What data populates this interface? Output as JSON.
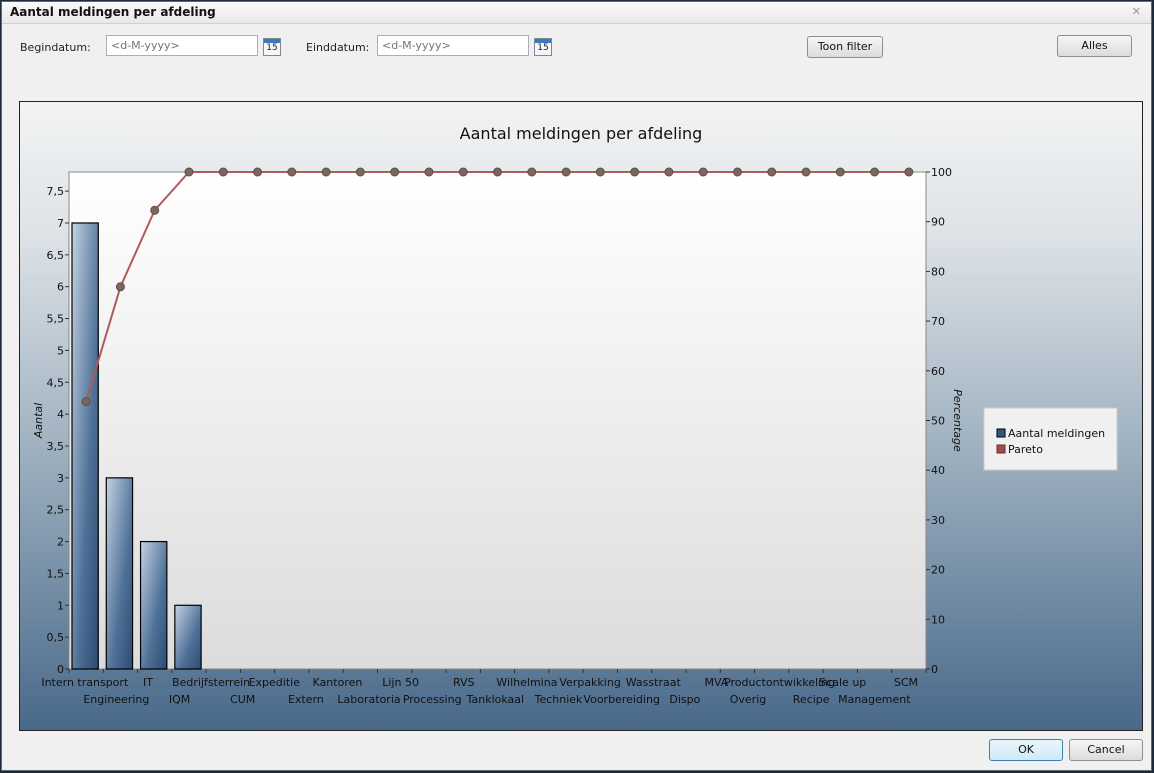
{
  "window": {
    "title": "Aantal meldingen per afdeling",
    "close_icon": "close-icon"
  },
  "filter": {
    "begin_label": "Begindatum:",
    "begin_placeholder": "<d-M-yyyy>",
    "end_label": "Einddatum:",
    "end_placeholder": "<d-M-yyyy>",
    "calendar_day": "15",
    "show_filter_label": "Toon filter",
    "all_label": "Alles"
  },
  "footer": {
    "ok_label": "OK",
    "cancel_label": "Cancel"
  },
  "colors": {
    "bar": "#34577d",
    "pareto": "#a84848",
    "dot": "#7a6a6a"
  },
  "chart_data": {
    "type": "bar",
    "title": "Aantal meldingen per afdeling",
    "xlabel": "",
    "ylabel": "Aantal",
    "y2label": "Percentage",
    "ylim": [
      0,
      7.8
    ],
    "y2lim": [
      0,
      100
    ],
    "yticks": [
      "0",
      "0,5",
      "1",
      "1,5",
      "2",
      "2,5",
      "3",
      "3,5",
      "4",
      "4,5",
      "5",
      "5,5",
      "6",
      "6,5",
      "7",
      "7,5"
    ],
    "y2ticks": [
      "0",
      "10",
      "20",
      "30",
      "40",
      "50",
      "60",
      "70",
      "80",
      "90",
      "100"
    ],
    "categories": [
      "Intern transport",
      "Engineering",
      "IT",
      "IQM",
      "Bedrijfsterrein",
      "CUM",
      "Expeditie",
      "Extern",
      "Kantoren",
      "Laboratoria",
      "Lijn 50",
      "Processing",
      "RVS",
      "Tanklokaal",
      "Wilhelmina",
      "Techniek",
      "Verpakking",
      "Voorbereiding",
      "Wasstraat",
      "Dispo",
      "MVA",
      "Overig",
      "Productontwikkeling",
      "Recipe",
      "Scale up",
      "Management",
      "SCM"
    ],
    "series": [
      {
        "name": "Aantal meldingen",
        "type": "bar",
        "values": [
          7,
          3,
          2,
          1,
          0,
          0,
          0,
          0,
          0,
          0,
          0,
          0,
          0,
          0,
          0,
          0,
          0,
          0,
          0,
          0,
          0,
          0,
          0,
          0,
          0,
          0,
          0
        ]
      },
      {
        "name": "Pareto",
        "type": "line",
        "axis": "right",
        "values": [
          53.8,
          76.9,
          92.3,
          100,
          100,
          100,
          100,
          100,
          100,
          100,
          100,
          100,
          100,
          100,
          100,
          100,
          100,
          100,
          100,
          100,
          100,
          100,
          100,
          100,
          100,
          100,
          100
        ]
      }
    ],
    "legend": [
      "Aantal meldingen",
      "Pareto"
    ],
    "legend_position": "right",
    "grid": false
  }
}
